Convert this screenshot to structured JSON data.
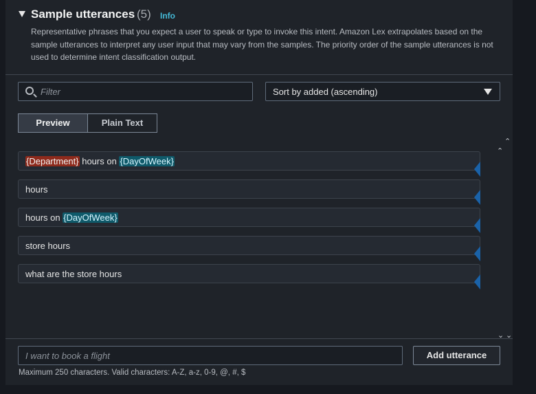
{
  "section": {
    "title": "Sample utterances",
    "count": "(5)",
    "info_label": "Info",
    "description": "Representative phrases that you expect a user to speak or type to invoke this intent. Amazon Lex extrapolates based on the sample utterances to interpret any user input that may vary from the samples. The priority order of the sample utterances is not used to determine intent classification output."
  },
  "filter": {
    "placeholder": "Filter",
    "icon": "search-icon"
  },
  "sort": {
    "selected": "Sort by added (ascending)",
    "icon": "caret-down-icon"
  },
  "view_toggle": {
    "preview": "Preview",
    "plain_text": "Plain Text",
    "active": "Preview"
  },
  "utterances": [
    {
      "parts": [
        {
          "text": "{Department}",
          "slot": "red"
        },
        {
          "text": " hours on "
        },
        {
          "text": "{DayOfWeek}",
          "slot": "teal"
        }
      ]
    },
    {
      "parts": [
        {
          "text": "hours"
        }
      ]
    },
    {
      "parts": [
        {
          "text": "hours on "
        },
        {
          "text": "{DayOfWeek}",
          "slot": "teal"
        }
      ]
    },
    {
      "parts": [
        {
          "text": "store hours"
        }
      ]
    },
    {
      "parts": [
        {
          "text": "what are the store hours"
        }
      ]
    }
  ],
  "new_utterance": {
    "placeholder": "I want to book a flight",
    "button": "Add utterance"
  },
  "hint": "Maximum 250 characters. Valid characters: A-Z, a-z, 0-9, @, #, $",
  "colors": {
    "slot_red": "#8e2a1c",
    "slot_teal": "#0f5a6a",
    "accent_info": "#44b9d6",
    "marker": "#1a62a8"
  }
}
